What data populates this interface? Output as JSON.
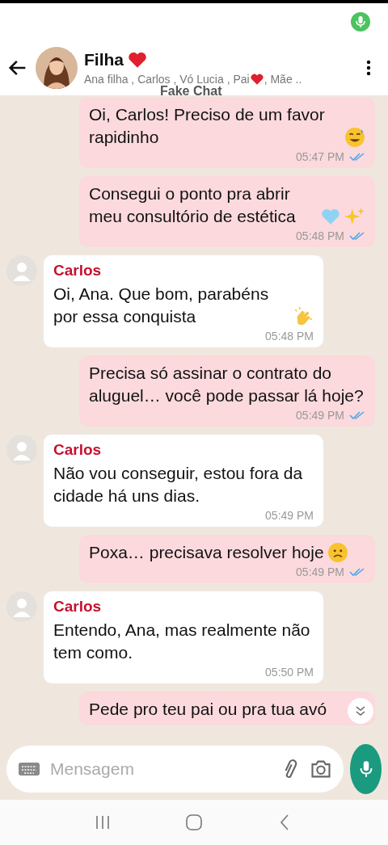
{
  "header": {
    "title": "Filha",
    "participants_before_heart": "Ana filha , Carlos , Vó Lucia , Pai",
    "participants_after_heart": ", Mãe ..",
    "app_label": "Fake Chat"
  },
  "messages": [
    {
      "kind": "outgoing",
      "text": "Oi, Carlos! Preciso de um favor rapidinho",
      "emojis": [
        {
          "kind": "sweat-smile"
        }
      ],
      "time": "05:47 PM",
      "read": true
    },
    {
      "kind": "outgoing",
      "text": "Consegui o ponto pra abrir meu consultório de estética",
      "emojis": [
        {
          "kind": "light-blue-heart"
        },
        {
          "kind": "sparkles"
        }
      ],
      "time": "05:48 PM",
      "read": true
    },
    {
      "kind": "incoming",
      "sender": "Carlos",
      "text": "Oi, Ana. Que bom, parabéns por essa conquista",
      "emojis": [
        {
          "kind": "clapping-hands"
        }
      ],
      "time": "05:48 PM"
    },
    {
      "kind": "outgoing",
      "text": "Precisa só assinar o contrato do aluguel… você pode passar lá hoje?",
      "time": "05:49 PM",
      "read": true
    },
    {
      "kind": "incoming",
      "sender": "Carlos",
      "text": "Não vou conseguir, estou fora da cidade há uns dias.",
      "time": "05:49 PM"
    },
    {
      "kind": "outgoing",
      "text": "Poxa… precisava resolver hoje",
      "emojis": [
        {
          "kind": "frowning-face"
        }
      ],
      "time": "05:49 PM",
      "read": true
    },
    {
      "kind": "incoming",
      "sender": "Carlos",
      "text": "Entendo, Ana, mas realmente não tem como.",
      "time": "05:50 PM"
    },
    {
      "kind": "outgoing-cut",
      "text": "Pede pro teu pai ou pra tua avó"
    }
  ],
  "composer": {
    "placeholder": "Mensagem"
  }
}
